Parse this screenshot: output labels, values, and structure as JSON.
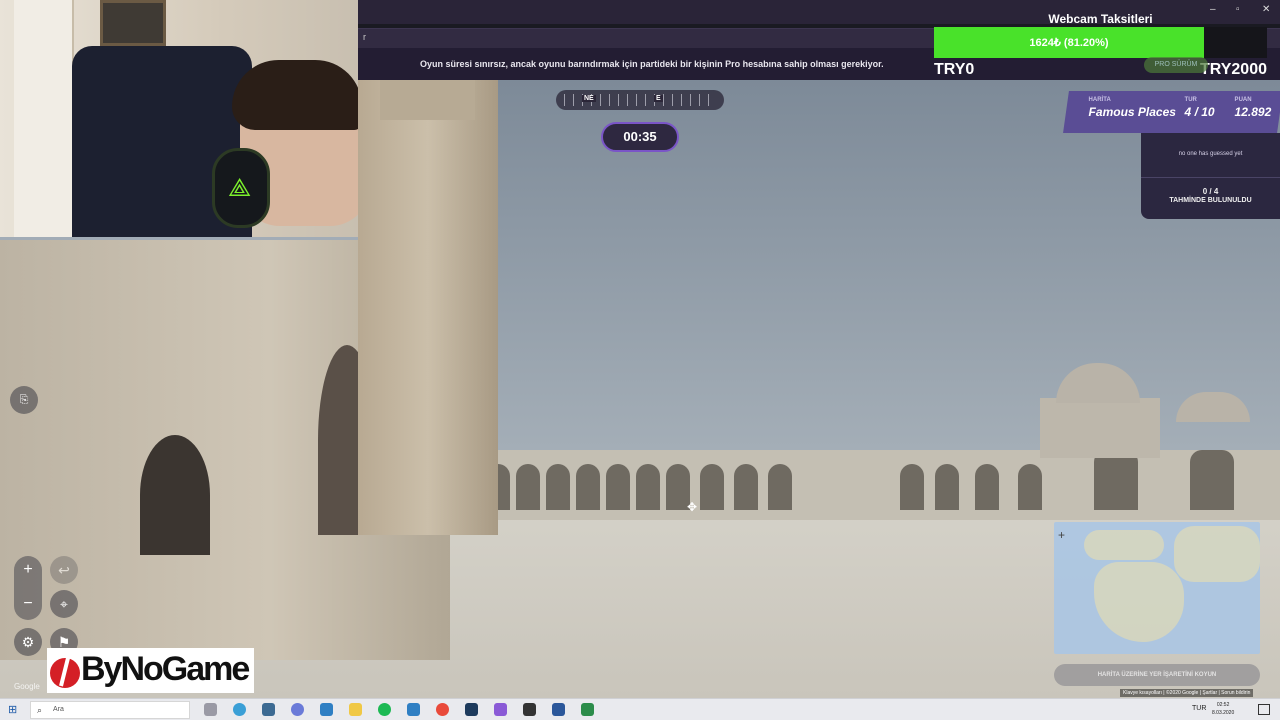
{
  "browser": {
    "url_text": "r",
    "info_message": "Oyun süresi sınırsız, ancak oyunu barındırmak için partideki bir kişinin Pro hesabına sahip olması gerekiyor."
  },
  "game": {
    "compass": {
      "labels": [
        "NE",
        "E"
      ]
    },
    "timer": "00:35",
    "status": {
      "map_label": "HARİTA",
      "map_value": "Famous Places",
      "round_label": "TUR",
      "round_value": "4 / 10",
      "score_label": "PUAN",
      "score_value": "12.892"
    },
    "guess_panel": {
      "note": "no one has guessed yet",
      "count": "0 / 4",
      "caption": "TAHMİNDE BULUNULDU"
    },
    "pro_button_label": "PRO SÜRÜM",
    "guess_button_label": "HARİTA ÜZERİNE YER İŞARETİNİ KOYUN",
    "map_footer": "Klavye kısayolları | ©2020 Google | Şartlar | Sorun bildirin",
    "google_logo": "Google"
  },
  "overlay": {
    "donation": {
      "title": "Webcam Taksitleri",
      "current": "1624₺ (81.20%)",
      "progress_percent": 81.2,
      "min_label": "TRY0",
      "max_label": "TRY2000",
      "fill_color": "#49e22a"
    },
    "logo_text": "ByNoGame"
  },
  "taskbar": {
    "search_placeholder": "Ara",
    "language": "TUR",
    "time": "02:52",
    "date": "8.03.2020",
    "apps": [
      "edge",
      "store",
      "discord",
      "explorer",
      "spotify",
      "vscode",
      "chrome",
      "photoshop",
      "twitch",
      "game",
      "word",
      "obs"
    ]
  }
}
